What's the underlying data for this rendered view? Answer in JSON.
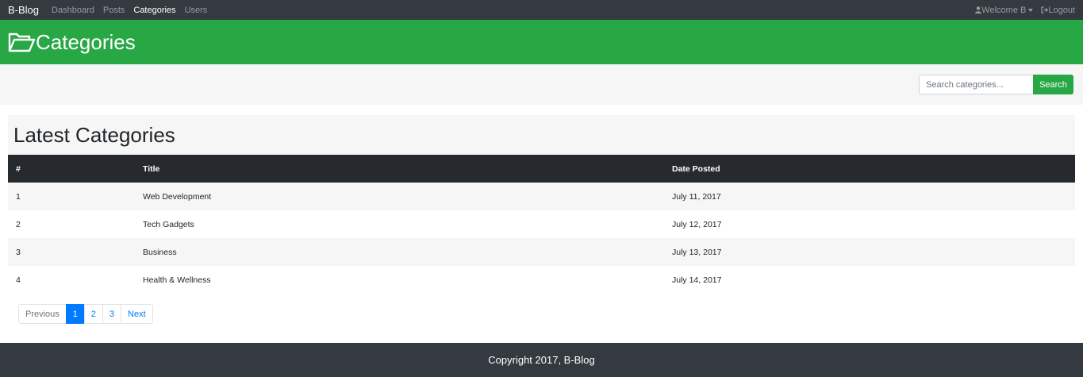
{
  "nav": {
    "brand": "B-Blog",
    "links": [
      "Dashboard",
      "Posts",
      "Categories",
      "Users"
    ],
    "active": "Categories",
    "welcome": "Welcome B",
    "logout": "Logout"
  },
  "header": {
    "icon": "folder-open-icon",
    "title": "Categories"
  },
  "search": {
    "placeholder": "Search categories...",
    "value": "",
    "button": "Search"
  },
  "main": {
    "heading": "Latest Categories",
    "columns": [
      "#",
      "Title",
      "Date Posted"
    ],
    "rows": [
      [
        "1",
        "Web Development",
        "July 11, 2017"
      ],
      [
        "2",
        "Tech Gadgets",
        "July 12, 2017"
      ],
      [
        "3",
        "Business",
        "July 13, 2017"
      ],
      [
        "4",
        "Health & Wellness",
        "July 14, 2017"
      ]
    ]
  },
  "pagination": {
    "previous": "Previous",
    "pages": [
      "1",
      "2",
      "3"
    ],
    "current": "1",
    "next": "Next"
  },
  "footer": {
    "text": "Copyright 2017, B-Blog"
  },
  "colors": {
    "navbar": "#343a40",
    "header": "#28a745",
    "table_head": "#262a2e",
    "accent": "#007bff"
  }
}
